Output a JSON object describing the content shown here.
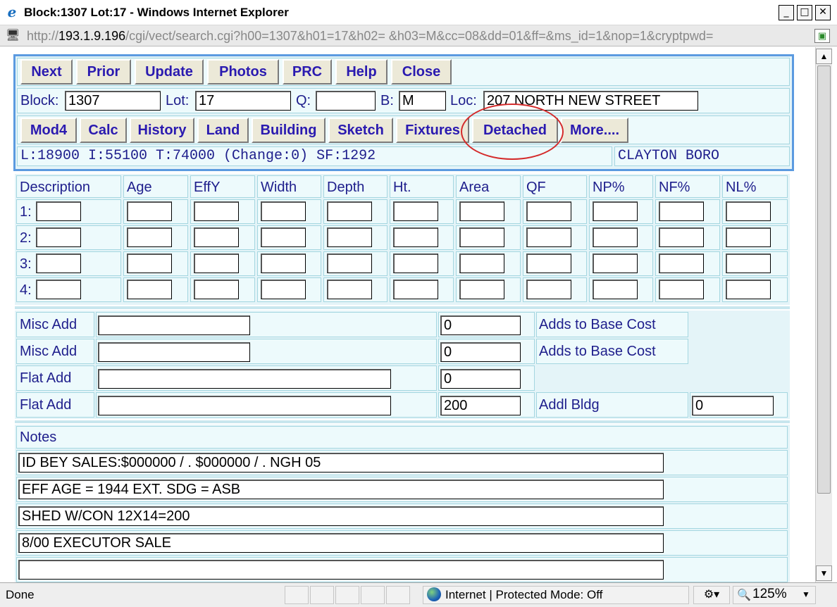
{
  "window": {
    "title": "Block:1307 Lot:17 - Windows Internet Explorer",
    "minimize": "_",
    "maximize": "□",
    "close": "✕"
  },
  "address": {
    "prefix": "http://",
    "host": "193.1.9.196",
    "path": "/cgi/vect/search.cgi?h00=1307&h01=17&h02= &h03=M&cc=08&dd=01&ff=&ms_id=1&nop=1&cryptpwd="
  },
  "toolbar1": {
    "next": "Next",
    "prior": "Prior",
    "update": "Update",
    "photos": "Photos",
    "prc": "PRC",
    "help": "Help",
    "close": "Close"
  },
  "property": {
    "block_label": "Block:",
    "block_value": "1307",
    "lot_label": "Lot:",
    "lot_value": "17",
    "q_label": "Q:",
    "q_value": "",
    "b_label": "B:",
    "b_value": "M",
    "loc_label": "Loc:",
    "loc_value": "207 NORTH NEW STREET"
  },
  "toolbar2": {
    "mod4": "Mod4",
    "calc": "Calc",
    "history": "History",
    "land": "Land",
    "building": "Building",
    "sketch": "Sketch",
    "fixtures": "Fixtures",
    "detached": "Detached",
    "more": "More...."
  },
  "summary": {
    "values": "L:18900 I:55100 T:74000 (Change:0) SF:1292",
    "municipality": "CLAYTON BORO"
  },
  "detached_table": {
    "headers": [
      "Description",
      "Age",
      "EffY",
      "Width",
      "Depth",
      "Ht.",
      "Area",
      "QF",
      "NP%",
      "NF%",
      "NL%"
    ],
    "rows": [
      {
        "label": "1:",
        "values": [
          "",
          "",
          "",
          "",
          "",
          "",
          "",
          "",
          "",
          "",
          ""
        ]
      },
      {
        "label": "2:",
        "values": [
          "",
          "",
          "",
          "",
          "",
          "",
          "",
          "",
          "",
          "",
          ""
        ]
      },
      {
        "label": "3:",
        "values": [
          "",
          "",
          "",
          "",
          "",
          "",
          "",
          "",
          "",
          "",
          ""
        ]
      },
      {
        "label": "4:",
        "values": [
          "",
          "",
          "",
          "",
          "",
          "",
          "",
          "",
          "",
          "",
          ""
        ]
      }
    ]
  },
  "additions": [
    {
      "label": "Misc Add",
      "description": "",
      "amount": "0",
      "note": "Adds to Base Cost"
    },
    {
      "label": "Misc Add",
      "description": "",
      "amount": "0",
      "note": "Adds to Base Cost"
    },
    {
      "label": "Flat Add",
      "description": "",
      "amount": "0",
      "note": ""
    },
    {
      "label": "Flat Add",
      "description": "",
      "amount": "200",
      "note": "Addl Bldg",
      "addl_value": "0"
    }
  ],
  "notes": {
    "heading": "Notes",
    "lines": [
      "ID BEY SALES:$000000   /   .    $000000   /   .    NGH 05",
      "EFF AGE = 1944 EXT. SDG = ASB",
      "SHED W/CON 12X14=200",
      "8/00 EXECUTOR SALE",
      ""
    ]
  },
  "status": {
    "left": "Done",
    "zone": "Internet | Protected Mode: Off",
    "zoom": "125%"
  }
}
